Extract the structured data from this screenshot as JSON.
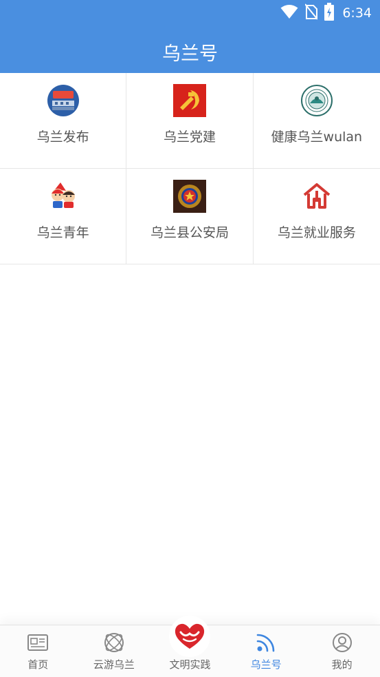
{
  "status_bar": {
    "time": "6:34",
    "icons": [
      "wifi-icon",
      "no-sim-icon",
      "battery-charging-icon"
    ]
  },
  "header": {
    "title": "乌兰号"
  },
  "accounts": [
    {
      "label": "乌兰发布",
      "icon": "wulan-release-logo"
    },
    {
      "label": "乌兰党建",
      "icon": "party-emblem-icon"
    },
    {
      "label": "健康乌兰wulan",
      "icon": "health-wulan-seal"
    },
    {
      "label": "乌兰青年",
      "icon": "youth-cartoon-icon"
    },
    {
      "label": "乌兰县公安局",
      "icon": "police-emblem-icon"
    },
    {
      "label": "乌兰就业服务",
      "icon": "employment-service-icon"
    }
  ],
  "bottom_nav": [
    {
      "label": "首页",
      "icon": "newspaper-icon",
      "active": false
    },
    {
      "label": "云游乌兰",
      "icon": "orbit-icon",
      "active": false
    },
    {
      "label": "文明实践",
      "icon": "heart-icon",
      "active": false
    },
    {
      "label": "乌兰号",
      "icon": "rss-feed-icon",
      "active": true
    },
    {
      "label": "我的",
      "icon": "user-profile-icon",
      "active": false
    }
  ],
  "colors": {
    "header_bg": "#4a8fe0",
    "active_tab": "#3e86e0",
    "heart_red": "#d9262c",
    "divider": "#e6e6e6"
  }
}
